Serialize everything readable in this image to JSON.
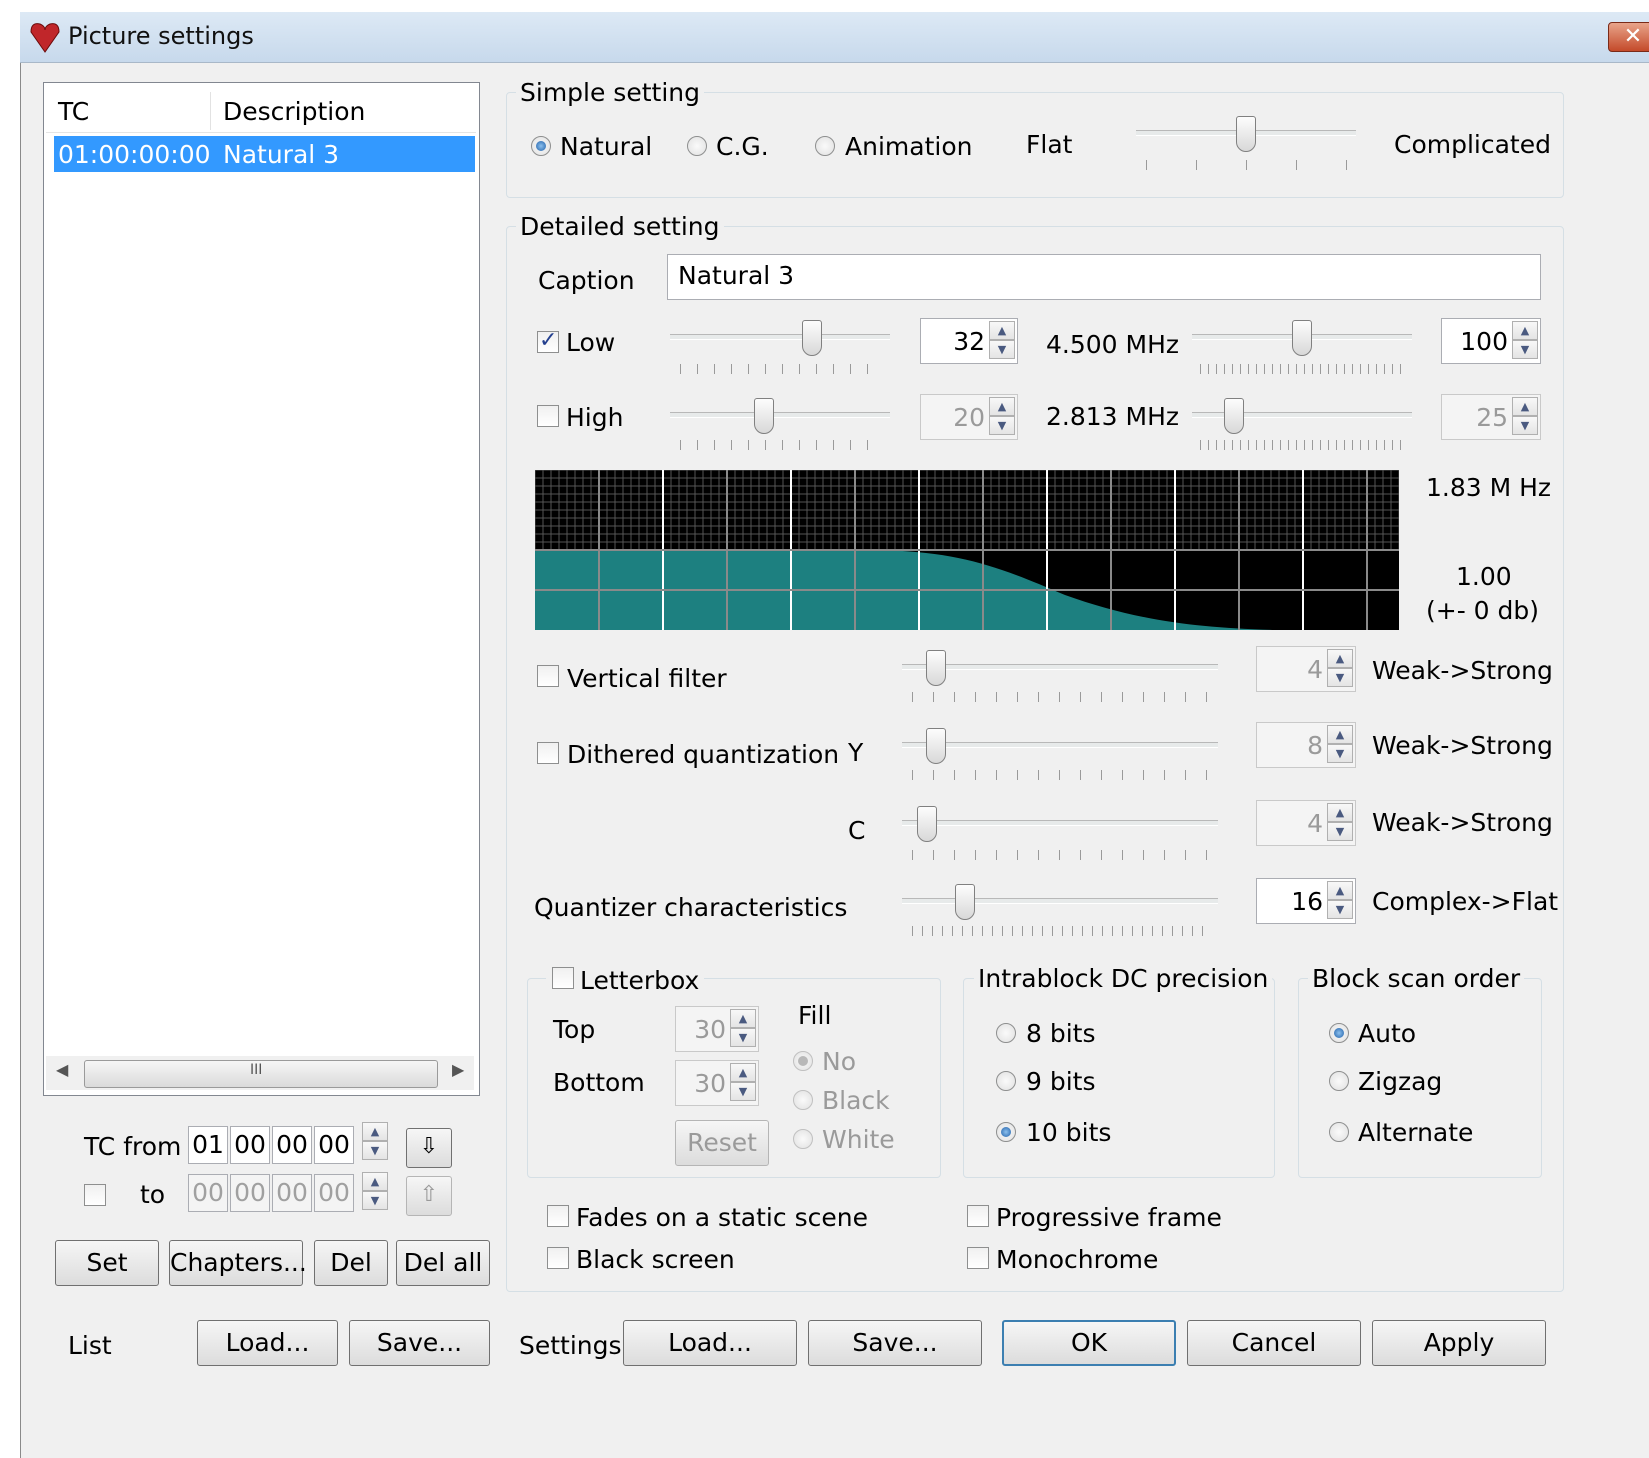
{
  "window": {
    "title": "Picture settings",
    "close": "✕"
  },
  "list": {
    "headers": [
      "TC",
      "Description"
    ],
    "rows": [
      {
        "tc": "01:00:00:00",
        "desc": "Natural 3"
      }
    ],
    "scroll_grip": "III"
  },
  "tc": {
    "from_label": "TC from",
    "to_label": "to",
    "from": [
      "01",
      "00",
      "00",
      "00"
    ],
    "to": [
      "00",
      "00",
      "00",
      "00"
    ],
    "to_checked": false
  },
  "list_buttons": {
    "set": "Set",
    "chapters": "Chapters...",
    "del": "Del",
    "del_all": "Del all"
  },
  "simple": {
    "title": "Simple setting",
    "options": [
      "Natural",
      "C.G.",
      "Animation"
    ],
    "selected": "Natural",
    "flat": "Flat",
    "complicated": "Complicated",
    "slider_level": 0.5
  },
  "detailed": {
    "title": "Detailed setting",
    "caption_label": "Caption",
    "caption_value": "Natural 3",
    "low": {
      "label": "Low",
      "checked": true,
      "value": "32",
      "freq": "4.500 MHz",
      "value2": "100",
      "slider1": 0.66,
      "slider2": 0.5
    },
    "high": {
      "label": "High",
      "checked": false,
      "value": "20",
      "freq": "2.813 MHz",
      "value2": "25",
      "slider1": 0.42,
      "slider2": 0.16
    },
    "graph_freq": "1.83 M Hz",
    "graph_gain": "1.00",
    "graph_db": "(+- 0 db)",
    "colors": {
      "grid_bg": "#000000",
      "fill": "#1d8080",
      "grid_line": "#555555"
    }
  },
  "filters": {
    "vertical": {
      "label": "Vertical filter",
      "checked": false,
      "value": "4",
      "scale": "Weak->Strong",
      "level": 0.08
    },
    "dithered": {
      "label": "Dithered quantization",
      "checked": false
    },
    "y": {
      "label": "Y",
      "value": "8",
      "scale": "Weak->Strong",
      "level": 0.08
    },
    "c": {
      "label": "C",
      "value": "4",
      "scale": "Weak->Strong",
      "level": 0.05
    },
    "quantizer": {
      "label": "Quantizer characteristics",
      "value": "16",
      "scale": "Complex->Flat",
      "level": 0.18
    }
  },
  "letterbox": {
    "label": "Letterbox",
    "checked": false,
    "top_label": "Top",
    "top_value": "30",
    "bottom_label": "Bottom",
    "bottom_value": "30",
    "fill_label": "Fill",
    "fill_options": [
      "No",
      "Black",
      "White"
    ],
    "fill_selected": "No",
    "reset": "Reset"
  },
  "intrablock": {
    "title": "Intrablock DC precision",
    "options": [
      "8 bits",
      "9 bits",
      "10 bits"
    ],
    "selected": "10 bits"
  },
  "scan": {
    "title": "Block scan order",
    "options": [
      "Auto",
      "Zigzag",
      "Alternate"
    ],
    "selected": "Auto"
  },
  "options": {
    "fades": "Fades on a static scene",
    "black_screen": "Black screen",
    "progressive": "Progressive frame",
    "monochrome": "Monochrome"
  },
  "footer": {
    "list_label": "List",
    "list_load": "Load...",
    "list_save": "Save...",
    "settings_label": "Settings",
    "settings_load": "Load...",
    "settings_save": "Save...",
    "ok": "OK",
    "cancel": "Cancel",
    "apply": "Apply"
  }
}
